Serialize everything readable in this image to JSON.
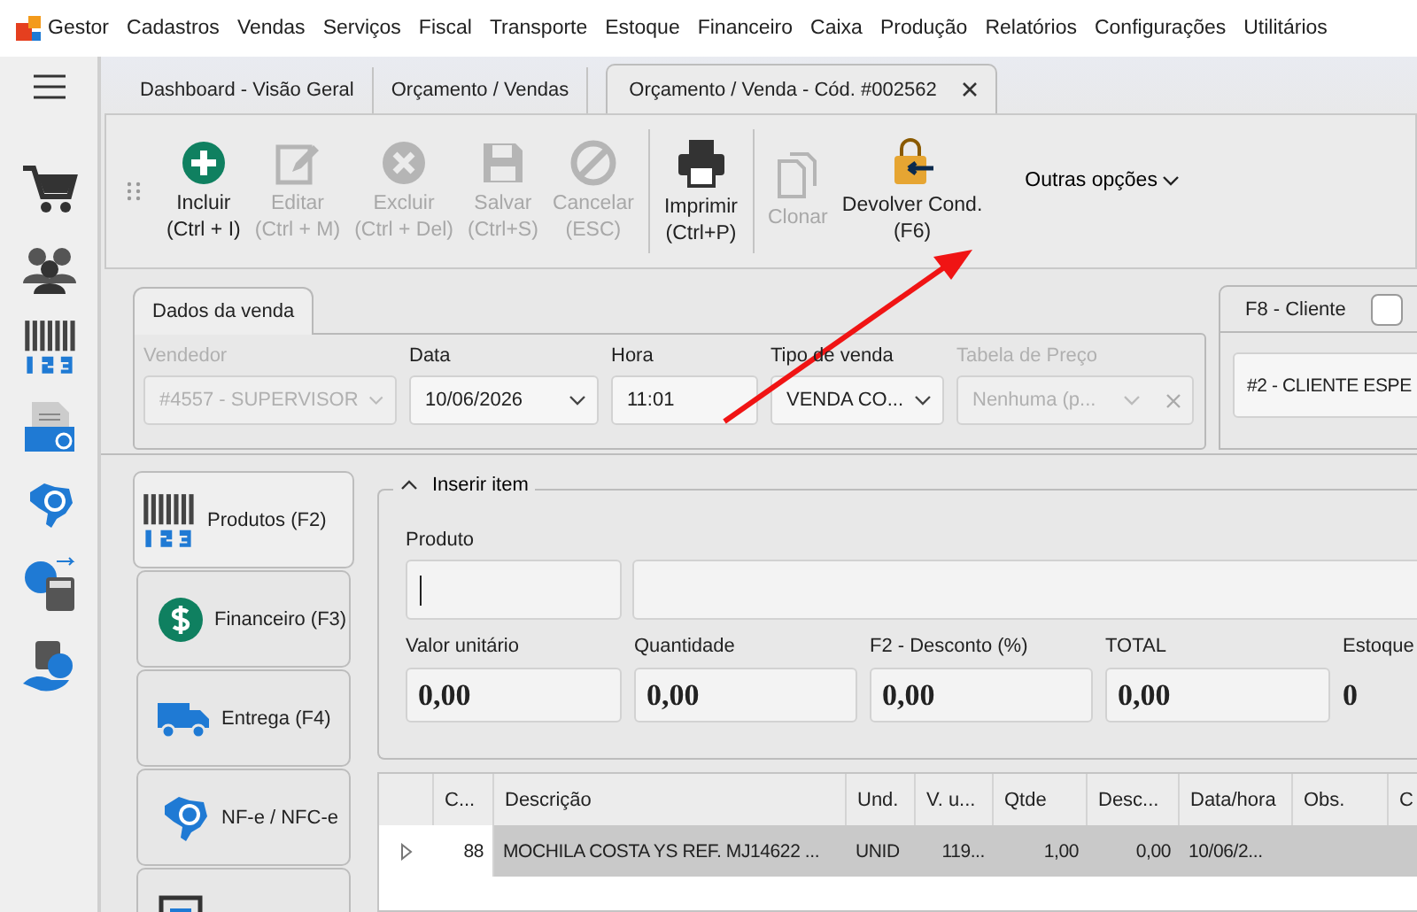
{
  "menu": {
    "app": "Gestor",
    "items": [
      "Cadastros",
      "Vendas",
      "Serviços",
      "Fiscal",
      "Transporte",
      "Estoque",
      "Financeiro",
      "Caixa",
      "Produção",
      "Relatórios",
      "Configurações",
      "Utilitários"
    ]
  },
  "tabs": [
    {
      "label": "Dashboard - Visão Geral",
      "selected": false
    },
    {
      "label": "Orçamento / Vendas",
      "selected": false
    },
    {
      "label": "Orçamento / Venda - Cód. #002562",
      "selected": true
    }
  ],
  "toolbar": {
    "buttons": [
      {
        "label": "Incluir",
        "shortcut": "(Ctrl + I)",
        "disabled": false
      },
      {
        "label": "Editar",
        "shortcut": "(Ctrl + M)",
        "disabled": true
      },
      {
        "label": "Excluir",
        "shortcut": "(Ctrl + Del)",
        "disabled": true
      },
      {
        "label": "Salvar",
        "shortcut": "(Ctrl+S)",
        "disabled": true
      },
      {
        "label": "Cancelar",
        "shortcut": "(ESC)",
        "disabled": true
      },
      {
        "label": "Imprimir",
        "shortcut": "(Ctrl+P)",
        "disabled": false
      },
      {
        "label": "Clonar",
        "disabled": true
      },
      {
        "label": "Devolver Cond.",
        "shortcut": "(F6)",
        "disabled": false
      }
    ],
    "more": "Outras opções"
  },
  "sale": {
    "tab": "Dados da venda",
    "fields": [
      {
        "label": "Vendedor",
        "value": "#4557 - SUPERVISOR",
        "kind": "select",
        "disabled": true
      },
      {
        "label": "Data",
        "value": "10/06/2026",
        "kind": "select",
        "disabled": false
      },
      {
        "label": "Hora",
        "value": "11:01",
        "kind": "text",
        "disabled": false
      },
      {
        "label": "Tipo de venda",
        "value": "VENDA CO...",
        "kind": "select",
        "disabled": false
      },
      {
        "label": "Tabela de Preço",
        "value": "Nenhuma (p...",
        "kind": "clearable",
        "disabled": true
      }
    ]
  },
  "client": {
    "tab": "F8 - Cliente",
    "checked": false,
    "value": "#2 - CLIENTE ESPE"
  },
  "side_tabs": [
    {
      "label": "Produtos (F2)",
      "selected": true
    },
    {
      "label": "Financeiro (F3)",
      "selected": false
    },
    {
      "label": "Entrega (F4)",
      "selected": false
    },
    {
      "label": "NF-e / NFC-e",
      "selected": false
    },
    {
      "selected": false
    }
  ],
  "insert": {
    "legend": "Inserir item",
    "expanded": true,
    "product_label": "Produto",
    "values": [
      {
        "label": "Valor unitário",
        "value": "0,00",
        "kind": "field"
      },
      {
        "label": "Quantidade",
        "value": "0,00",
        "kind": "field"
      },
      {
        "label": "F2 - Desconto (%)",
        "value": "0,00",
        "kind": "field"
      },
      {
        "label": "TOTAL",
        "value": "0,00",
        "kind": "field"
      },
      {
        "label": "Estoque",
        "value": "0",
        "kind": "plain"
      }
    ]
  },
  "table": {
    "columns": [
      "C...",
      "Descrição",
      "Und.",
      "V. u...",
      "Qtde",
      "Desc...",
      "Data/hora",
      "Obs.",
      "C"
    ],
    "rows": [
      {
        "selected": true,
        "cells": [
          "88",
          "MOCHILA COSTA YS REF. MJ14622 ...",
          "UNID",
          "119...",
          "1,00",
          "0,00",
          "10/06/2...",
          "",
          ""
        ]
      }
    ]
  }
}
